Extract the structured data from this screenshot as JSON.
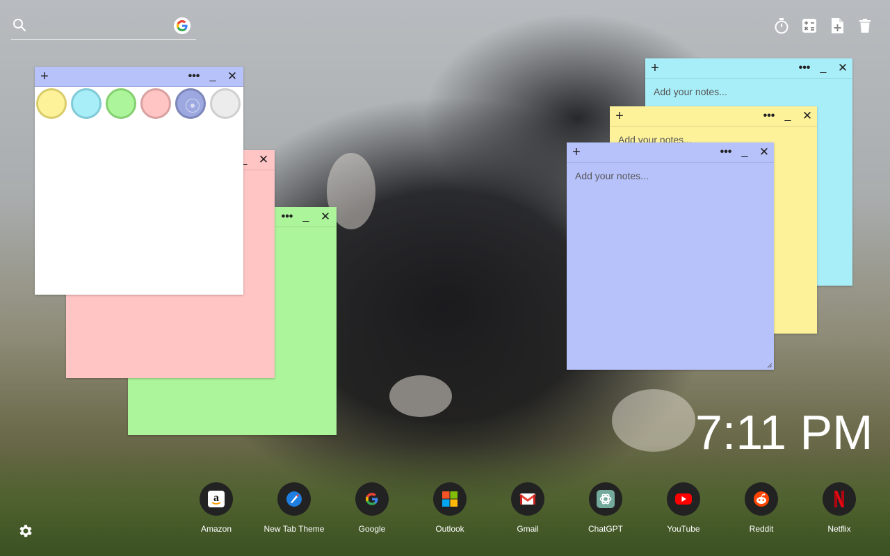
{
  "search": {
    "placeholder": "",
    "value": ""
  },
  "tools": [
    "timer-icon",
    "calculator-icon",
    "new-note-icon",
    "trash-icon"
  ],
  "palette": [
    {
      "name": "yellow",
      "fill": "#fdf29a",
      "border": "#d8cc6a"
    },
    {
      "name": "cyan",
      "fill": "#a8eef8",
      "border": "#7fcad6"
    },
    {
      "name": "green",
      "fill": "#adf59b",
      "border": "#84cf70"
    },
    {
      "name": "pink",
      "fill": "#ffc4c4",
      "border": "#d9a0a0"
    },
    {
      "name": "lavender",
      "fill": "#9da8e0",
      "border": "#7c86b8"
    },
    {
      "name": "gray",
      "fill": "#ececec",
      "border": "#cfcfcf"
    }
  ],
  "notes": [
    {
      "color": "#fdf29a",
      "placeholder": "Add your notes..."
    },
    {
      "color": "#a8eef8",
      "placeholder": "Add your notes..."
    },
    {
      "color": "#b7c2fb",
      "placeholder": "Add your notes..."
    },
    {
      "color": "#ffc4c4",
      "placeholder": ""
    },
    {
      "color": "#adf59b",
      "placeholder": ""
    },
    {
      "color": "#ffffff",
      "placeholder": ""
    }
  ],
  "note_controls": {
    "add": "+",
    "more": "•••",
    "minimize": "_",
    "close": "✕"
  },
  "clock": {
    "time": "7:11 PM"
  },
  "dock": [
    {
      "label": "Amazon",
      "icon": "amazon-icon"
    },
    {
      "label": "New Tab Theme",
      "icon": "new-tab-theme-icon"
    },
    {
      "label": "Google",
      "icon": "google-icon"
    },
    {
      "label": "Outlook",
      "icon": "outlook-icon"
    },
    {
      "label": "Gmail",
      "icon": "gmail-icon"
    },
    {
      "label": "ChatGPT",
      "icon": "chatgpt-icon"
    },
    {
      "label": "YouTube",
      "icon": "youtube-icon"
    },
    {
      "label": "Reddit",
      "icon": "reddit-icon"
    },
    {
      "label": "Netflix",
      "icon": "netflix-icon"
    }
  ],
  "settings": {
    "icon": "gear-icon"
  }
}
